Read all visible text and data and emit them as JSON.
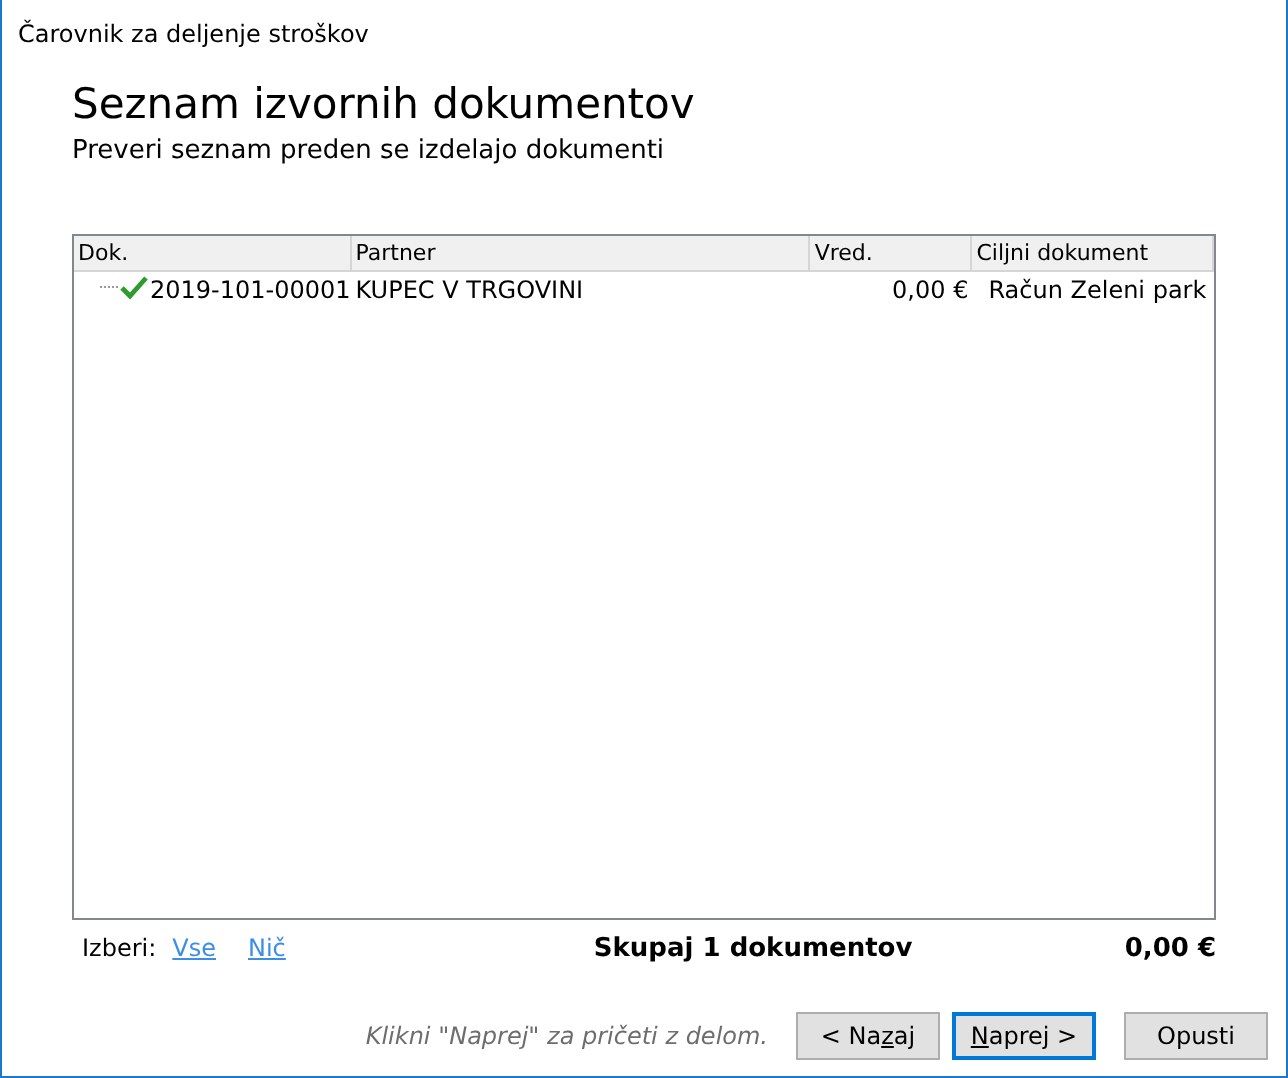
{
  "window": {
    "title": "Čarovnik za deljenje stroškov"
  },
  "header": {
    "title": "Seznam izvornih dokumentov",
    "subtitle": "Preveri seznam preden se izdelajo dokumenti"
  },
  "table": {
    "columns": [
      "Dok.",
      "Partner",
      "Vred.",
      "Ciljni dokument"
    ],
    "rows": [
      {
        "checked": true,
        "cells": [
          "2019-101-00001",
          "KUPEC V TRGOVINI",
          "0,00 €",
          "Račun Zeleni park"
        ]
      }
    ]
  },
  "footer": {
    "select_label": "Izberi:",
    "select_links": [
      "Vse",
      "Nič"
    ],
    "total_label": "Skupaj 1 dokumentov",
    "total_value": "0,00 €"
  },
  "hint": "Klikni \"Naprej\" za pričeti z delom.",
  "buttons": [
    {
      "before": "< Na",
      "accel": "z",
      "after": "aj",
      "default": false
    },
    {
      "accel": "N",
      "after": "aprej >",
      "default": true
    },
    {
      "before": "Opusti",
      "default": false
    }
  ]
}
